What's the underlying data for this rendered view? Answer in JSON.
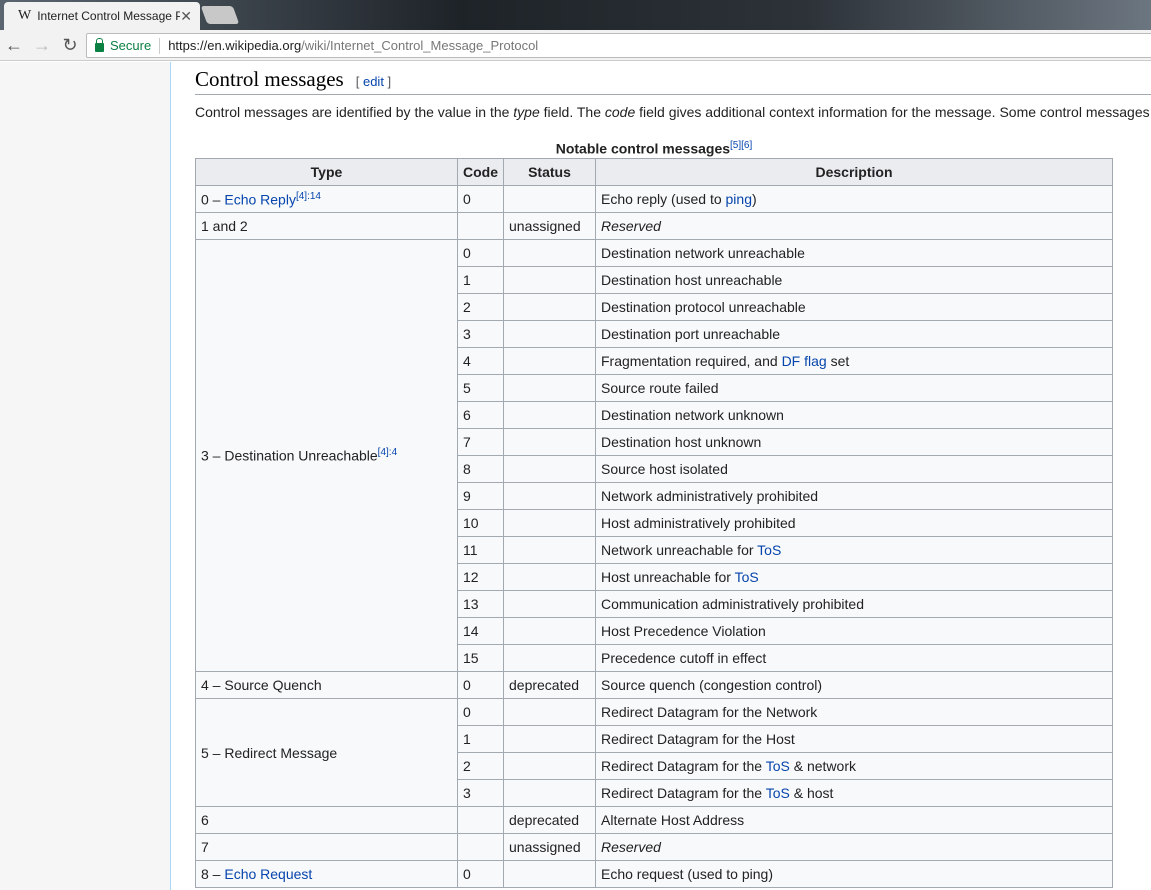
{
  "browser": {
    "tab_title": "Internet Control Message Protocol",
    "tab_icon": "W",
    "url_secure_label": "Secure",
    "url_host": "https://en.wikipedia.org",
    "url_path": "/wiki/Internet_Control_Message_Protocol"
  },
  "section": {
    "title": "Control messages",
    "edit": "edit",
    "intro_parts": [
      "Control messages are identified by the value in the ",
      "type",
      " field. The ",
      "code",
      " field gives additional context information for the message. Some control messages"
    ]
  },
  "table": {
    "caption": "Notable control messages",
    "caption_refs": "[5][6]",
    "headers": [
      "Type",
      "Code",
      "Status",
      "Description"
    ],
    "groups": [
      {
        "type": "0 – ",
        "type_link": "Echo Reply",
        "ref": "[4]:14",
        "rows": [
          {
            "code": "0",
            "status": "",
            "desc": [
              {
                "t": "Echo reply (used to "
              },
              {
                "t": "ping",
                "link": true
              },
              {
                "t": ")"
              }
            ]
          }
        ]
      },
      {
        "type": "1 and 2",
        "rows": [
          {
            "code": "",
            "status": "unassigned",
            "desc": [
              {
                "t": "Reserved",
                "i": true
              }
            ]
          }
        ]
      },
      {
        "type": "3 – Destination Unreachable",
        "ref": "[4]:4",
        "rows": [
          {
            "code": "0",
            "desc": [
              {
                "t": "Destination network unreachable"
              }
            ]
          },
          {
            "code": "1",
            "desc": [
              {
                "t": "Destination host unreachable"
              }
            ]
          },
          {
            "code": "2",
            "desc": [
              {
                "t": "Destination protocol unreachable"
              }
            ]
          },
          {
            "code": "3",
            "desc": [
              {
                "t": "Destination port unreachable"
              }
            ]
          },
          {
            "code": "4",
            "desc": [
              {
                "t": "Fragmentation required, and "
              },
              {
                "t": "DF flag",
                "link": true
              },
              {
                "t": " set"
              }
            ]
          },
          {
            "code": "5",
            "desc": [
              {
                "t": "Source route failed"
              }
            ]
          },
          {
            "code": "6",
            "desc": [
              {
                "t": "Destination network unknown"
              }
            ]
          },
          {
            "code": "7",
            "desc": [
              {
                "t": "Destination host unknown"
              }
            ]
          },
          {
            "code": "8",
            "desc": [
              {
                "t": "Source host isolated"
              }
            ]
          },
          {
            "code": "9",
            "desc": [
              {
                "t": "Network administratively prohibited"
              }
            ]
          },
          {
            "code": "10",
            "desc": [
              {
                "t": "Host administratively prohibited"
              }
            ]
          },
          {
            "code": "11",
            "desc": [
              {
                "t": "Network unreachable for "
              },
              {
                "t": "ToS",
                "link": true
              }
            ]
          },
          {
            "code": "12",
            "desc": [
              {
                "t": "Host unreachable for "
              },
              {
                "t": "ToS",
                "link": true
              }
            ]
          },
          {
            "code": "13",
            "desc": [
              {
                "t": "Communication administratively prohibited"
              }
            ]
          },
          {
            "code": "14",
            "desc": [
              {
                "t": "Host Precedence Violation"
              }
            ]
          },
          {
            "code": "15",
            "desc": [
              {
                "t": "Precedence cutoff in effect"
              }
            ]
          }
        ]
      },
      {
        "type": "4 – Source Quench",
        "rows": [
          {
            "code": "0",
            "status": "deprecated",
            "desc": [
              {
                "t": "Source quench (congestion control)"
              }
            ]
          }
        ]
      },
      {
        "type": "5 – Redirect Message",
        "rows": [
          {
            "code": "0",
            "desc": [
              {
                "t": "Redirect Datagram for the Network"
              }
            ]
          },
          {
            "code": "1",
            "desc": [
              {
                "t": "Redirect Datagram for the Host"
              }
            ]
          },
          {
            "code": "2",
            "desc": [
              {
                "t": "Redirect Datagram for the "
              },
              {
                "t": "ToS",
                "link": true
              },
              {
                "t": " & network"
              }
            ]
          },
          {
            "code": "3",
            "desc": [
              {
                "t": "Redirect Datagram for the "
              },
              {
                "t": "ToS",
                "link": true
              },
              {
                "t": " & host"
              }
            ]
          }
        ]
      },
      {
        "type": "6",
        "rows": [
          {
            "code": "",
            "status": "deprecated",
            "desc": [
              {
                "t": "Alternate Host Address"
              }
            ]
          }
        ]
      },
      {
        "type": "7",
        "rows": [
          {
            "code": "",
            "status": "unassigned",
            "desc": [
              {
                "t": "Reserved",
                "i": true
              }
            ]
          }
        ]
      },
      {
        "type": "8 – ",
        "type_link": "Echo Request",
        "rows": [
          {
            "code": "0",
            "status": "",
            "desc": [
              {
                "t": "Echo request (used to ping)"
              }
            ]
          }
        ]
      }
    ]
  }
}
